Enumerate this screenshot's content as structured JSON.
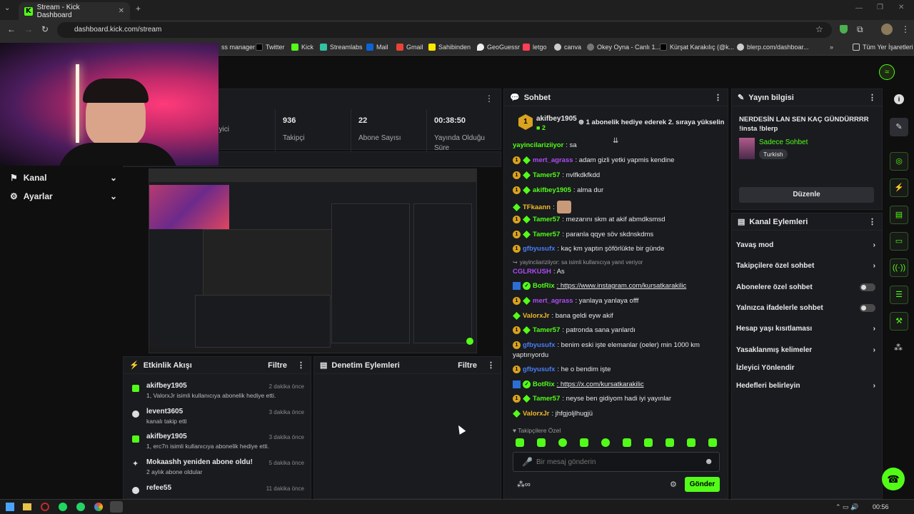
{
  "browser": {
    "tab_title": "Stream - Kick Dashboard",
    "url": "dashboard.kick.com/stream",
    "bookmarks": [
      "ss manager",
      "Twitter",
      "Kick",
      "Streamlabs",
      "Mail",
      "Gmail",
      "Sahibinden",
      "GeoGuessr",
      "letgo",
      "canva",
      "Okey Oyna - Canlı 1...",
      "Kürşat Karakılıç (@k...",
      "blerp.com/dashboar...",
      "Tüm Yer İşaretleri"
    ]
  },
  "sidebar": {
    "items": [
      {
        "label": "Kanal"
      },
      {
        "label": "Ayarlar"
      }
    ]
  },
  "stats": [
    {
      "value": "",
      "label": "İzleyici"
    },
    {
      "value": "936",
      "label": "Takipçi"
    },
    {
      "value": "22",
      "label": "Abone Sayısı"
    },
    {
      "value": "00:38:50",
      "label": "Yayında Olduğu Süre"
    }
  ],
  "activity": {
    "title": "Etkinlik Akışı",
    "filter": "Filtre",
    "events": [
      {
        "name": "akifbey1905",
        "time": "2 dakika önce",
        "desc": "1, ValorxJr isimli kullanıcıya abonelik hediye etti."
      },
      {
        "name": "levent3605",
        "time": "3 dakika önce",
        "desc": "kanalı takip etti"
      },
      {
        "name": "akifbey1905",
        "time": "3 dakika önce",
        "desc": "1, erc7n isimli kullanıcıya abonelik hediye etti."
      },
      {
        "name": "Mokaashh yeniden abone oldu!",
        "time": "5 dakika önce",
        "desc": "2 aylık abone oldular"
      },
      {
        "name": "refee55",
        "time": "11 dakika önce",
        "desc": ""
      }
    ]
  },
  "moderation": {
    "title": "Denetim Eylemleri",
    "filter": "Filtre"
  },
  "chat": {
    "title": "Sohbet",
    "pinned_user": "akifbey1905",
    "pinned_count": "2",
    "pinned_text": "1 abonelik hediye ederek 2. sıraya yükselin",
    "messages": [
      {
        "user": "yayincilariziiyor",
        "text": ": sa"
      },
      {
        "user": "mert_agrass",
        "text": ": adam gizli yetki yapmis kendine"
      },
      {
        "user": "Tamer57",
        "text": ": nvlfkdkfkdd"
      },
      {
        "user": "akifbey1905",
        "text": ": alma dur"
      },
      {
        "user": "TFkaann",
        "text": ":"
      },
      {
        "user": "Tamer57",
        "text": ": mezarını skm at akif abmdksmsd"
      },
      {
        "user": "Tamer57",
        "text": ": paranla qqye söv skdnskdms"
      },
      {
        "user": "gfbyusufx",
        "text": ": kaç km yaptın şöförlükte bir günde"
      },
      {
        "user": "CGLRKUSH",
        "text": ": As"
      },
      {
        "user": "BotRix",
        "text": ": https://www.instagram.com/kursatkarakilic"
      },
      {
        "user": "mert_agrass",
        "text": ": yanlaya yanlaya offf"
      },
      {
        "user": "ValorxJr",
        "text": ": bana geldi eyw akif"
      },
      {
        "user": "Tamer57",
        "text": ": patronda sana yanlardı"
      },
      {
        "user": "gfbyusufx",
        "text": ": benim eski işte elemanlar (oeler) min 1000 km"
      },
      {
        "user": "gfbyusufx",
        "text": ": he o bendim işte"
      },
      {
        "user": "BotRix",
        "text": ": https://x.com/kursatkarakilic"
      },
      {
        "user": "Tamer57",
        "text": ": neyse ben gidiyom hadi iyi yayınlar"
      },
      {
        "user": "ValorxJr",
        "text": ": jhfgjoljlhugjü"
      }
    ],
    "reply_hint": "yayinciiariziiyor: sa isimli kullanıcıya yanıt veriyor",
    "wrap_text": "yaptırıyordu",
    "followers_only": "Takipçilere Özel",
    "input_placeholder": "Bir mesaj gönderin",
    "send": "Gönder"
  },
  "stream_info": {
    "title": "Yayın bilgisi",
    "stream_title": "NERDESİN LAN SEN KAÇ GÜNDÜRRRR !insta !blerp",
    "category": "Sadece Sohbet",
    "language": "Turkish",
    "edit": "Düzenle"
  },
  "channel_actions": {
    "title": "Kanal Eylemleri",
    "items": [
      {
        "label": "Yavaş mod"
      },
      {
        "label": "Takipçilere özel sohbet"
      },
      {
        "label": "Abonelere özel sohbet"
      },
      {
        "label": "Yalnızca ifadelerle sohbet"
      },
      {
        "label": "Hesap yaşı kısıtlaması"
      },
      {
        "label": "Yasaklanmış kelimeler"
      },
      {
        "label": "İzleyici Yönlendir"
      },
      {
        "label": "Hedefleri belirleyin"
      }
    ]
  },
  "clock": "00:56",
  "colors": {
    "brand": "#53fc18",
    "panel": "#191b1f",
    "bg": "#0f0f10"
  }
}
